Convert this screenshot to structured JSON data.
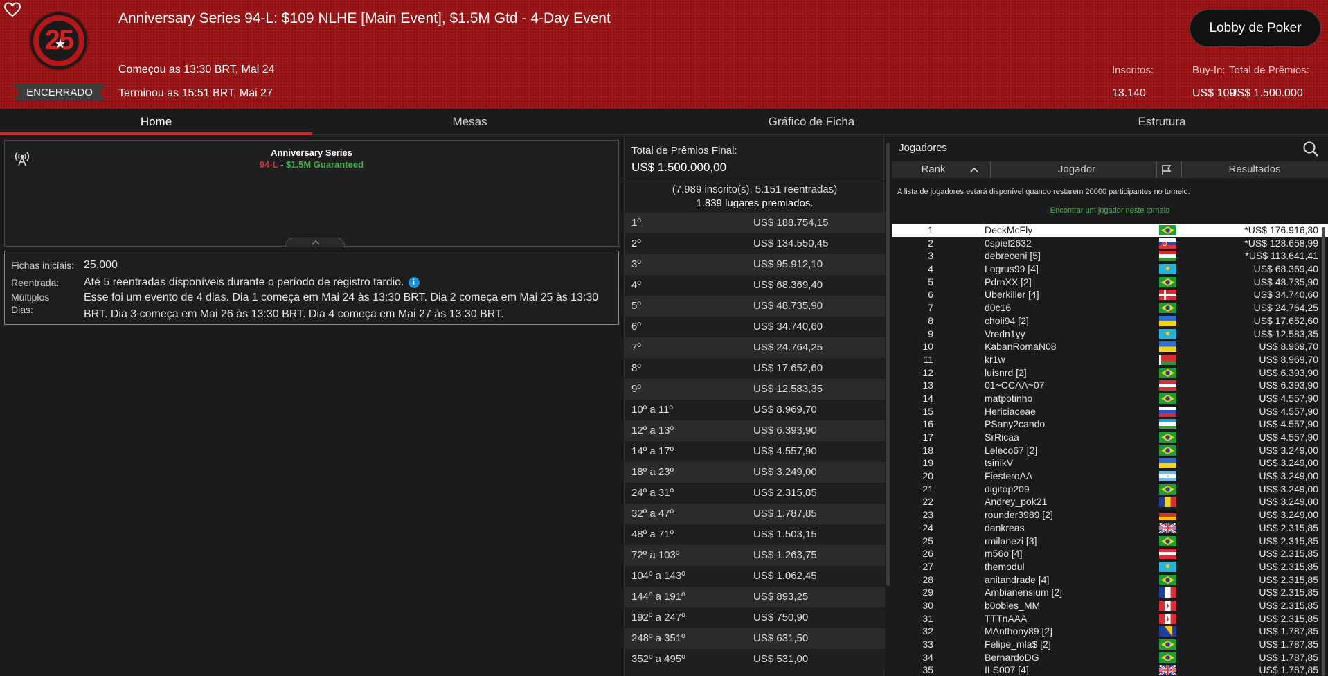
{
  "header": {
    "title": "Anniversary Series 94-L: $109 NLHE [Main Event], $1.5M Gtd - 4-Day Event",
    "logo_text": "25",
    "status": "ENCERRADO",
    "started": "Começou as 13:30 BRT, Mai 24",
    "ended": "Terminou as 15:51 BRT, Mai 27",
    "lobby_button": "Lobby de Poker",
    "stats": [
      {
        "label": "Inscritos:",
        "value": "13.140"
      },
      {
        "label": "Buy-In:",
        "value": "US$ 109"
      },
      {
        "label": "Total de Prêmios:",
        "value": "US$ 1.500.000"
      }
    ]
  },
  "tabs": [
    "Home",
    "Mesas",
    "Gráfico de Ficha",
    "Estrutura"
  ],
  "active_tab": "Home",
  "banner": {
    "title": "Anniversary Series",
    "number": "94-L",
    "dash": " - ",
    "guarantee": "$1.5M Guaranteed"
  },
  "details": {
    "chips_label": "Fichas iniciais:",
    "chips_value": "25.000",
    "reentry_label": "Reentrada:",
    "reentry_value": "Até 5 reentradas disponíveis durante o período de registro tardio.",
    "multi_label_1": "Múltiplos",
    "multi_label_2": "Dias:",
    "multi_value": "Esse foi um evento de 4 dias. Dia 1 começa em Mai 24 às 13:30 BRT. Dia 2 começa em Mai 25 às 13:30 BRT. Dia 3 começa em Mai 26 às 13:30 BRT. Dia 4 começa em Mai 27 às 13:30 BRT."
  },
  "prizes": {
    "total_label": "Total de Prêmios Final:",
    "total_value": "US$ 1.500.000,00",
    "entries": "(7.989 inscrito(s), 5.151 reentradas)",
    "paid": "1.839 lugares premiados.",
    "rows": [
      {
        "place": "1º",
        "amount": "US$ 188.754,15"
      },
      {
        "place": "2º",
        "amount": "US$ 134.550,45"
      },
      {
        "place": "3º",
        "amount": "US$ 95.912,10"
      },
      {
        "place": "4º",
        "amount": "US$ 68.369,40"
      },
      {
        "place": "5º",
        "amount": "US$ 48.735,90"
      },
      {
        "place": "6º",
        "amount": "US$ 34.740,60"
      },
      {
        "place": "7º",
        "amount": "US$ 24.764,25"
      },
      {
        "place": "8º",
        "amount": "US$ 17.652,60"
      },
      {
        "place": "9º",
        "amount": "US$ 12.583,35"
      },
      {
        "place": "10º a 11º",
        "amount": "US$ 8.969,70"
      },
      {
        "place": "12º a 13º",
        "amount": "US$ 6.393,90"
      },
      {
        "place": "14º a 17º",
        "amount": "US$ 4.557,90"
      },
      {
        "place": "18º a 23º",
        "amount": "US$ 3.249,00"
      },
      {
        "place": "24º a 31º",
        "amount": "US$ 2.315,85"
      },
      {
        "place": "32º a 47º",
        "amount": "US$ 1.787,85"
      },
      {
        "place": "48º a 71º",
        "amount": "US$ 1.503,15"
      },
      {
        "place": "72º a 103º",
        "amount": "US$ 1.263,75"
      },
      {
        "place": "104º a 143º",
        "amount": "US$ 1.062,45"
      },
      {
        "place": "144º a 191º",
        "amount": "US$ 893,25"
      },
      {
        "place": "192º a 247º",
        "amount": "US$ 750,90"
      },
      {
        "place": "248º a 351º",
        "amount": "US$ 631,50"
      },
      {
        "place": "352º a 495º",
        "amount": "US$ 531,00"
      }
    ]
  },
  "players": {
    "title": "Jogadores",
    "col_rank": "Rank",
    "col_player": "Jogador",
    "col_results": "Resultados",
    "note": "A lista de jogadores estará disponível quando restarem 20000 participantes no torneio.",
    "find_link": "Encontrar um jogador neste torneio",
    "rows": [
      {
        "rank": "1",
        "name": "DeckMcFly",
        "flag": "brazil",
        "result": "*US$ 176.916,30"
      },
      {
        "rank": "2",
        "name": "0spiel2632",
        "flag": "slovakia",
        "result": "*US$ 128.658,99"
      },
      {
        "rank": "3",
        "name": "debreceni [5]",
        "flag": "hungary",
        "result": "*US$ 113.641,41"
      },
      {
        "rank": "4",
        "name": "Logrus99 [4]",
        "flag": "kazakhstan",
        "result": "US$ 68.369,40"
      },
      {
        "rank": "5",
        "name": "PdrnXX [2]",
        "flag": "brazil",
        "result": "US$ 48.735,90"
      },
      {
        "rank": "6",
        "name": "Überkiller [4]",
        "flag": "denmark",
        "result": "US$ 34.740,60"
      },
      {
        "rank": "7",
        "name": "d0c16",
        "flag": "brazil",
        "result": "US$ 24.764,25"
      },
      {
        "rank": "8",
        "name": "choii94 [2]",
        "flag": "ukraine",
        "result": "US$ 17.652,60"
      },
      {
        "rank": "9",
        "name": "Vredn1yy",
        "flag": "kazakhstan",
        "result": "US$ 12.583,35"
      },
      {
        "rank": "10",
        "name": "KabanRomaN08",
        "flag": "ukraine",
        "result": "US$ 8.969,70"
      },
      {
        "rank": "11",
        "name": "kr1w",
        "flag": "belarus",
        "result": "US$ 8.969,70"
      },
      {
        "rank": "12",
        "name": "luisnrd [2]",
        "flag": "brazil",
        "result": "US$ 6.393,90"
      },
      {
        "rank": "13",
        "name": "01~CCAA~07",
        "flag": "austria",
        "result": "US$ 6.393,90"
      },
      {
        "rank": "14",
        "name": "matpotinho",
        "flag": "brazil",
        "result": "US$ 4.557,90"
      },
      {
        "rank": "15",
        "name": "Hericiaceae",
        "flag": "russia",
        "result": "US$ 4.557,90"
      },
      {
        "rank": "16",
        "name": "PSany2cando",
        "flag": "uzbekistan",
        "result": "US$ 4.557,90"
      },
      {
        "rank": "17",
        "name": "SrRicaa",
        "flag": "brazil",
        "result": "US$ 4.557,90"
      },
      {
        "rank": "18",
        "name": "Leleco67 [2]",
        "flag": "brazil",
        "result": "US$ 3.249,00"
      },
      {
        "rank": "19",
        "name": "tsinikV",
        "flag": "ukraine",
        "result": "US$ 3.249,00"
      },
      {
        "rank": "20",
        "name": "FiesteroAA",
        "flag": "argentina",
        "result": "US$ 3.249,00"
      },
      {
        "rank": "21",
        "name": "digitop209",
        "flag": "brazil",
        "result": "US$ 3.249,00"
      },
      {
        "rank": "22",
        "name": "Andrey_pok21",
        "flag": "romania",
        "result": "US$ 3.249,00"
      },
      {
        "rank": "23",
        "name": "rounder3989 [2]",
        "flag": "germany",
        "result": "US$ 3.249,00"
      },
      {
        "rank": "24",
        "name": "dankreas",
        "flag": "uk",
        "result": "US$ 2.315,85"
      },
      {
        "rank": "25",
        "name": "rmilanezi [3]",
        "flag": "brazil",
        "result": "US$ 2.315,85"
      },
      {
        "rank": "26",
        "name": "m56o [4]",
        "flag": "austria",
        "result": "US$ 2.315,85"
      },
      {
        "rank": "27",
        "name": "themodul",
        "flag": "kazakhstan",
        "result": "US$ 2.315,85"
      },
      {
        "rank": "28",
        "name": "anitandrade [4]",
        "flag": "brazil",
        "result": "US$ 2.315,85"
      },
      {
        "rank": "29",
        "name": "Ambianensium [2]",
        "flag": "france",
        "result": "US$ 2.315,85"
      },
      {
        "rank": "30",
        "name": "b0obies_MM",
        "flag": "canada",
        "result": "US$ 2.315,85"
      },
      {
        "rank": "31",
        "name": "TTTnAAA",
        "flag": "canada",
        "result": "US$ 2.315,85"
      },
      {
        "rank": "32",
        "name": "MAnthony89 [2]",
        "flag": "bosnia",
        "result": "US$ 1.787,85"
      },
      {
        "rank": "33",
        "name": "Felipe_mla$ [2]",
        "flag": "brazil",
        "result": "US$ 1.787,85"
      },
      {
        "rank": "34",
        "name": "BernardoDG",
        "flag": "brazil",
        "result": "US$ 1.787,85"
      },
      {
        "rank": "35",
        "name": "ILS007 [4]",
        "flag": "uk",
        "result": "US$ 1.787,85"
      }
    ]
  },
  "colors": {
    "header_red": "#9c1416",
    "accent_red": "#d31f26",
    "guarantee_green": "#3fae43",
    "link_green": "#3db94c",
    "info_blue": "#1f8fd6"
  }
}
